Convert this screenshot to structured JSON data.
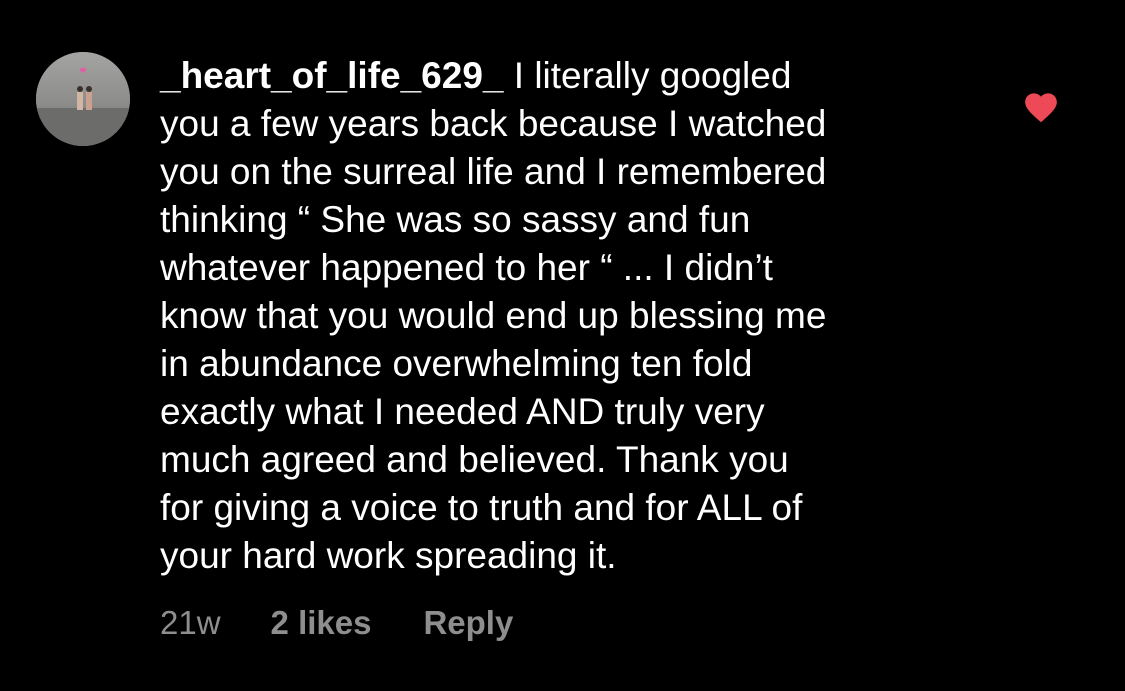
{
  "comment": {
    "username": "_heart_of_life_629_",
    "text": "I literally googled\nyou a few years back because I watched\nyou on the surreal life and I remembered\nthinking “ She was so sassy and fun\nwhatever happened to her “ ... I didn’t\nknow that you would end up blessing me\nin abundance overwhelming ten fold\nexactly what I needed AND truly very\nmuch agreed and believed. Thank you\nfor giving a voice to truth and for ALL of\nyour hard work spreading it.",
    "time": "21w",
    "likes": "2 likes",
    "reply_label": "Reply",
    "liked": true
  },
  "icons": {
    "like": "heart-icon",
    "avatar": "profile-photo"
  },
  "colors": {
    "background": "#000000",
    "text": "#ffffff",
    "meta_text": "#8e8e8e",
    "heart": "#ed4956"
  }
}
